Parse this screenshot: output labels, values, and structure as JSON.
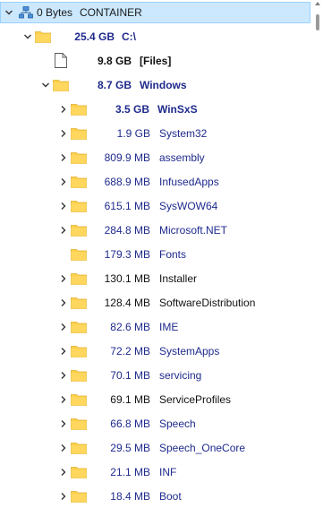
{
  "root": {
    "size": "0 Bytes",
    "name": "CONTAINER",
    "icon": "network-drive-icon"
  },
  "drive": {
    "size": "25.4 GB",
    "name": "C:\\",
    "icon": "folder-icon"
  },
  "files_node": {
    "size": "9.8 GB",
    "name": "[Files]",
    "icon": "file-icon"
  },
  "windows": {
    "size": "8.7 GB",
    "name": "Windows",
    "icon": "folder-icon"
  },
  "children": [
    {
      "size": "3.5 GB",
      "name": "WinSxS",
      "bold": true,
      "color": "blue",
      "expandable": true
    },
    {
      "size": "1.9 GB",
      "name": "System32",
      "color": "blue",
      "expandable": true
    },
    {
      "size": "809.9 MB",
      "name": "assembly",
      "color": "blue",
      "expandable": true
    },
    {
      "size": "688.9 MB",
      "name": "InfusedApps",
      "color": "blue",
      "expandable": true
    },
    {
      "size": "615.1 MB",
      "name": "SysWOW64",
      "color": "blue",
      "expandable": true
    },
    {
      "size": "284.8 MB",
      "name": "Microsoft.NET",
      "color": "blue",
      "expandable": true
    },
    {
      "size": "179.3 MB",
      "name": "Fonts",
      "color": "blue",
      "expandable": false
    },
    {
      "size": "130.1 MB",
      "name": "Installer",
      "color": "black",
      "expandable": true
    },
    {
      "size": "128.4 MB",
      "name": "SoftwareDistribution",
      "color": "black",
      "expandable": true
    },
    {
      "size": "82.6 MB",
      "name": "IME",
      "color": "blue",
      "expandable": true
    },
    {
      "size": "72.2 MB",
      "name": "SystemApps",
      "color": "blue",
      "expandable": true
    },
    {
      "size": "70.1 MB",
      "name": "servicing",
      "color": "blue",
      "expandable": true
    },
    {
      "size": "69.1 MB",
      "name": "ServiceProfiles",
      "color": "black",
      "expandable": true
    },
    {
      "size": "66.8 MB",
      "name": "Speech",
      "color": "blue",
      "expandable": true
    },
    {
      "size": "29.5 MB",
      "name": "Speech_OneCore",
      "color": "blue",
      "expandable": true
    },
    {
      "size": "21.1 MB",
      "name": "INF",
      "color": "blue",
      "expandable": true
    },
    {
      "size": "18.4 MB",
      "name": "Boot",
      "color": "blue",
      "expandable": true
    }
  ],
  "colors": {
    "folder": "#ffd04a",
    "folder_dark": "#e8b62c",
    "text_blue": "#1f2a8c",
    "selection": "#cce8ff"
  }
}
